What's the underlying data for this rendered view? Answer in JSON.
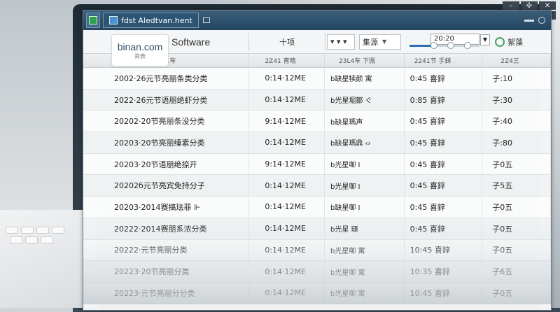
{
  "window": {
    "tabs": [
      {
        "label": ""
      },
      {
        "label": "fdst  Aledtvan.hent"
      }
    ]
  },
  "system_buttons": [
    "–",
    "✣",
    "✕",
    "▭",
    "◧",
    "⤢"
  ],
  "toolbar": {
    "logo_text": "binan.com",
    "logo_sub": "资表",
    "brand": "Software",
    "btn1": "十项",
    "select1": "▾ ▾ ▾",
    "select2": "集源",
    "time": "20:20",
    "label_right": "絮藻"
  },
  "colors": {
    "titlebar": "#2b4e6b",
    "accent": "#2d6fb3",
    "check_green": "#2aa14a"
  },
  "columns": [
    "2Z41车",
    "2Z41  育晴",
    "23L4车  下佩",
    "2241节  手銇",
    "2Z4三"
  ],
  "rows": [
    {
      "c1": "2002·26元节亮丽条类分类",
      "c2": "0:14·12ME",
      "c3": "b缺星犊颜 寓",
      "c4": "0:45  喜鋅",
      "c5": "子:10"
    },
    {
      "c1": "2022·26元节语朋绝虾分类",
      "c2": "0:14·12ME",
      "c3": "b光星堀鄒 ぐ",
      "c4": "0:85  喜鋅",
      "c5": "子:30"
    },
    {
      "c1": "20202·20节亮丽条没分类",
      "c2": "9:14·12ME",
      "c3": "b缺星瑪声",
      "c4": "0:45  喜鋅",
      "c5": "子:40"
    },
    {
      "c1": "20203·20节亮丽缍素分类",
      "c2": "0:14·12ME",
      "c3": "b缺星瑪鼎 ‹›",
      "c4": "0:45  喜鋅",
      "c5": "子:80"
    },
    {
      "c1": "20203·20节语朋绝捺开",
      "c2": "9:14·12ME",
      "c3": "b光星啣 Ⅰ",
      "c4": "0:45  喜鋅",
      "c5": "子0五"
    },
    {
      "c1": "20202б元节亮宾免持分子",
      "c2": "0:14·12ME",
      "c3": "b光星啣 Ⅰ",
      "c4": "0:45  喜鋅",
      "c5": "子5五"
    },
    {
      "c1": "20203·2014赛搞珐菲 ⊩",
      "c2": "0:14·12ME",
      "c3": "b缺星啣 Ⅰ",
      "c4": "0:45  喜鋅",
      "c5": "子0五"
    },
    {
      "c1": "20222·2014赛朋系浓分类",
      "c2": "0:14·12ME",
      "c3": "b光星 璭",
      "c4": "0:45  喜鋅",
      "c5": "子0五"
    },
    {
      "c1": "20222·元节亮丽分类",
      "c2": "0:14·12ME",
      "c3": "b光星啣 寓",
      "c4": "10:45  喜鋅",
      "c5": "子0五"
    },
    {
      "c1": "20223·20节亮丽分类",
      "c2": "0:14·12ME",
      "c3": "b光星啣 寓",
      "c4": "10:35  喜鋅",
      "c5": "子6五"
    },
    {
      "c1": "20223·元节亮丽分分类",
      "c2": "0:14·12ME",
      "c3": "b光星啣 寓",
      "c4": "10:45  喜鋅",
      "c5": "子0五"
    }
  ]
}
